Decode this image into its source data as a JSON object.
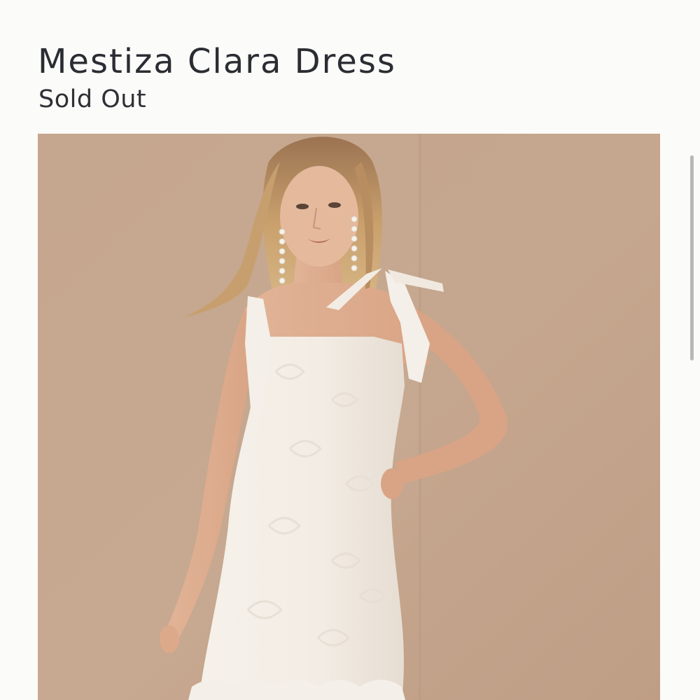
{
  "product": {
    "title": "Mestiza Clara Dress",
    "status": "Sold Out"
  },
  "image": {
    "subject": "model-wearing-white-floral-dress",
    "background_color": "#c9a88d",
    "dress_color": "#f3eee7"
  },
  "scrollbar": {
    "visible": true
  }
}
